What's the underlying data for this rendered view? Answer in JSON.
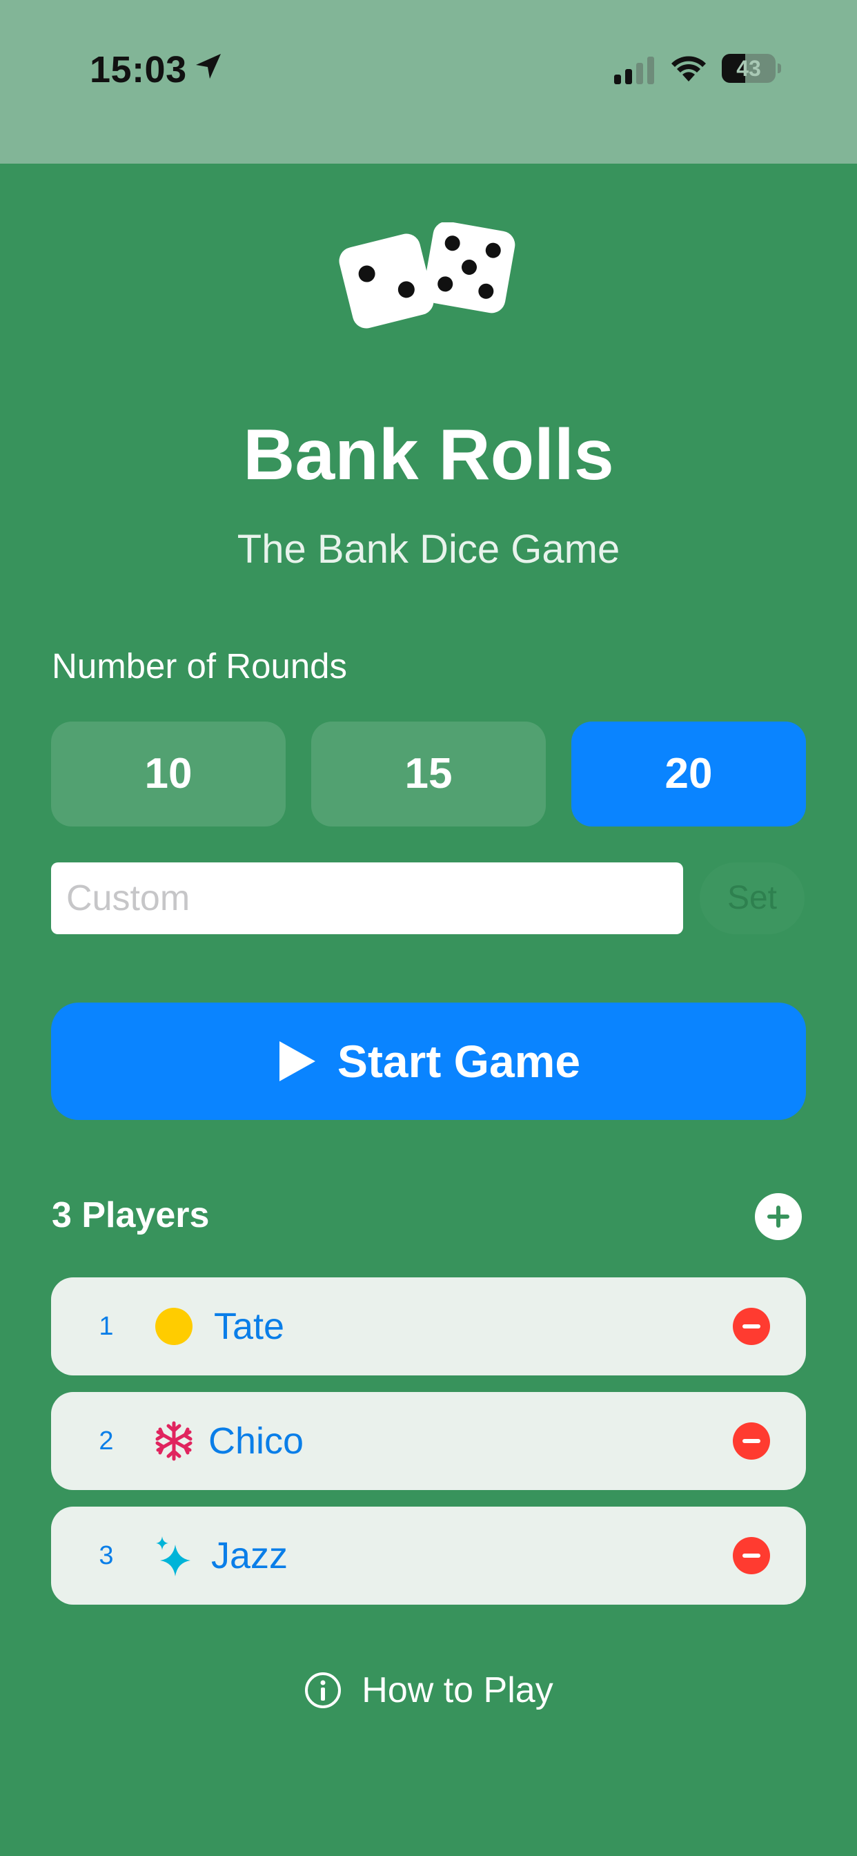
{
  "status_bar": {
    "time": "15:03",
    "battery": "43",
    "battery_level": 0.43,
    "icons": [
      "location-arrow-icon",
      "cellular-signal-icon",
      "wifi-icon",
      "battery-icon"
    ]
  },
  "app": {
    "logo_icon": "dice-icon",
    "title": "Bank Rolls",
    "subtitle": "The Bank Dice Game"
  },
  "rounds": {
    "label": "Number of Rounds",
    "options": [
      "10",
      "15",
      "20"
    ],
    "selected": "20",
    "custom_placeholder": "Custom",
    "custom_value": "",
    "set_label": "Set"
  },
  "start": {
    "icon": "play-icon",
    "label": "Start Game"
  },
  "players": {
    "count_label": "3 Players",
    "add_icon": "plus-icon",
    "list": [
      {
        "number": "1",
        "name": "Tate",
        "icon": "yellow-circle-icon"
      },
      {
        "number": "2",
        "name": "Chico",
        "icon": "snowflake-icon"
      },
      {
        "number": "3",
        "name": "Jazz",
        "icon": "sparkles-icon"
      }
    ],
    "remove_icon": "minus-circle-icon"
  },
  "footer": {
    "icon": "info-icon",
    "how_to_play": "How to Play"
  },
  "colors": {
    "background": "#38935c",
    "status_bar": "#82b597",
    "accent_blue": "#0a84ff",
    "round_unselected": "#52a171",
    "player_row": "#eaf1ec",
    "remove_red": "#ff3b30"
  }
}
